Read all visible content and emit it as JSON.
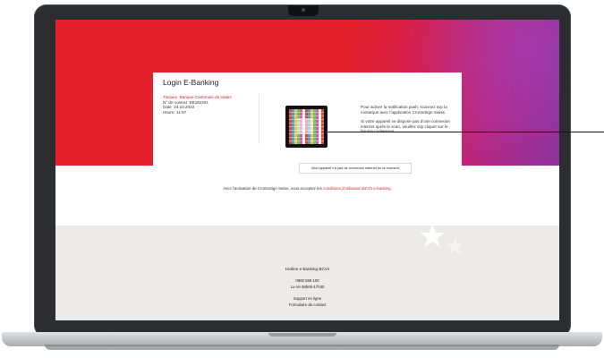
{
  "login": {
    "title": "Login E-Banking",
    "titulaire_label": "Titulaire",
    "titulaire_value": "Banque Cantonale du Valais",
    "contract_label": "N° de contrat",
    "contract_value": "EB182261",
    "date_label": "Date",
    "date_value": "24.10.2022",
    "time_label": "Heure",
    "time_value": "11:57"
  },
  "push": {
    "instruction": "Pour activer la notification push, scannez svp la mosaïque avec l'application CrontoSign Swiss.",
    "fallback": "Si votre appareil ne dispose pas d'une connexion internet après le scan, veuillez svp cliquer sur le bouton ci-dessous."
  },
  "no_connection_button": "Mon appareil n'a pas de connexion internet en ce moment",
  "terms": {
    "text": "Avec l'activation de CrontoSign Swiss, vous acceptez les ",
    "link": "conditions d'utilisation BCVs e-banking."
  },
  "footer": {
    "hotline_title": "Hotline e-banking BCVs",
    "phone": "0800 559 100",
    "hours": "Lu-Ve 08h00-17h30",
    "support_link": "Support en ligne",
    "contact_link": "Formulaire de contact"
  },
  "colors": {
    "brand_red": "#e5222b",
    "gradient_purple": "#8a2f98",
    "footer_bg": "#ecebe9"
  },
  "icons": {
    "qr_code": "cronto-mosaic-icon",
    "decoration": "star-icon"
  }
}
